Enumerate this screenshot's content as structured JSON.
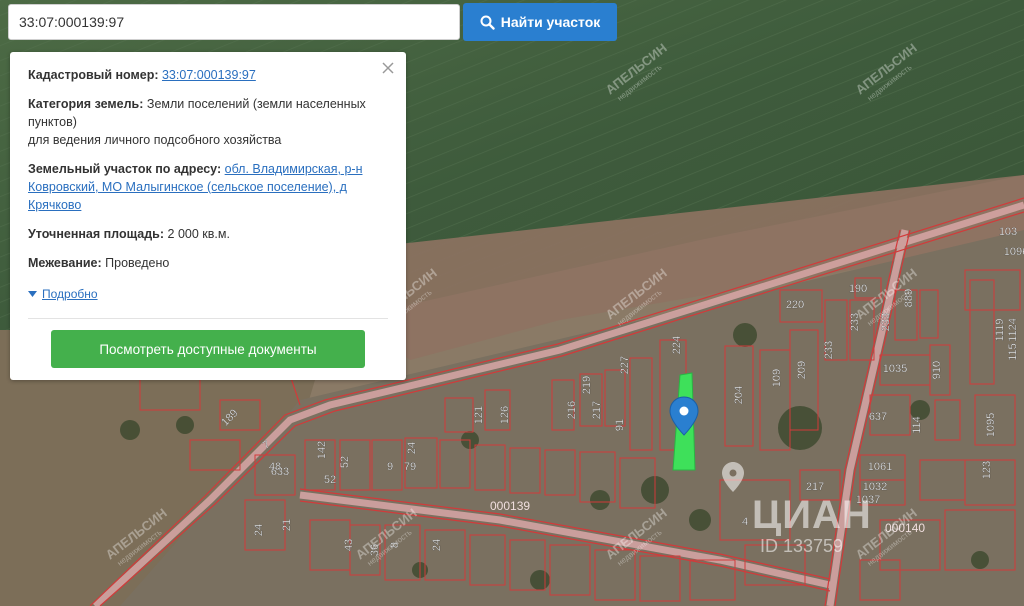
{
  "search": {
    "value": "33:07:000139:97",
    "button_label": "Найти участок"
  },
  "panel": {
    "cadastral_label": "Кадастровый номер:",
    "cadastral_value": "33:07:000139:97",
    "category_label": "Категория земель:",
    "category_value": "Земли поселений (земли населенных пунктов)",
    "usage_value": "для ведения личного подсобного хозяйства",
    "address_label": "Земельный участок по адресу:",
    "address_value": "обл. Владимирская, р-н Ковровский, МО Малыгинское (сельское поселение), д Крячково",
    "area_label": "Уточненная площадь:",
    "area_value": "2 000 кв.м.",
    "survey_label": "Межевание:",
    "survey_value": "Проведено",
    "more_label": "Подробно",
    "docs_button_label": "Посмотреть доступные документы"
  },
  "map": {
    "quarter_labels": [
      "000139",
      "000140"
    ],
    "plot_numbers": [
      "220",
      "190",
      "889",
      "233",
      "233",
      "1119",
      "1124",
      "233",
      "224",
      "219",
      "109",
      "209",
      "1035",
      "910",
      "227",
      "121",
      "126",
      "216",
      "217",
      "91",
      "204",
      "637",
      "114",
      "1095",
      "1096",
      "103",
      "115",
      "123",
      "1061",
      "1032",
      "1037",
      "217",
      "52",
      "142",
      "24",
      "9",
      "79",
      "633",
      "189",
      "7",
      "48",
      "52",
      "43",
      "36",
      "21",
      "24",
      "8",
      "24",
      "4"
    ],
    "watermark_text": "АПЕЛЬСИН",
    "watermark_subtext": "недвижимость",
    "cian_text": "ЦИАН",
    "cian_id": "ID 133759",
    "colors": {
      "field": "#3e5a3b",
      "parcel_outline": "#d23a3a",
      "road": "#d9a6a6",
      "highlight": "#3ee05a",
      "marker": "#2a7fd0"
    }
  }
}
